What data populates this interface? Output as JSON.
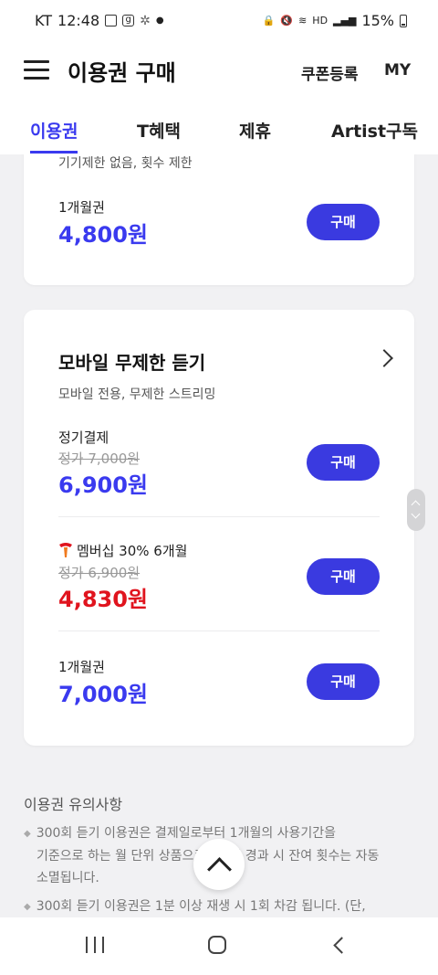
{
  "status_bar": {
    "carrier": "KT",
    "time": "12:48",
    "network_label": "HD",
    "battery": "15%"
  },
  "header": {
    "title": "이용권 구매",
    "coupon_label": "쿠폰등록",
    "my_label": "MY"
  },
  "tabs": [
    {
      "label": "이용권",
      "active": true
    },
    {
      "label": "T혜택",
      "active": false
    },
    {
      "label": "제휴",
      "active": false
    },
    {
      "label": "Artist구독",
      "active": false
    }
  ],
  "card1": {
    "desc_partial": "기기제한 없음, 횟수 제한",
    "plan_label": "1개월권",
    "price": "4,800원",
    "buy_label": "구매"
  },
  "card2": {
    "title": "모바일 무제한 듣기",
    "desc": "모바일 전용, 무제한 스트리밍",
    "plans": [
      {
        "label": "정기결제",
        "original_price": "정가 7,000원",
        "price": "6,900원",
        "buy_label": "구매"
      },
      {
        "label": "멤버십 30% 6개월",
        "original_price": "정가 6,900원",
        "price": "4,830원",
        "buy_label": "구매"
      },
      {
        "label": "1개월권",
        "price": "7,000원",
        "buy_label": "구매"
      }
    ]
  },
  "notes": {
    "title": "이용권 유의사항",
    "items": [
      {
        "line1": "300회 듣기 이용권은 결제일로부터 1개월의 사용기간을",
        "line2": "기준으로 하는 월 단위 상품으로 1개월 경과 시 잔여 횟수는 자동",
        "line3": "소멸됩니다."
      },
      {
        "line1": "300회 듣기 이용권은 1분 이상 재생 시 1회 차감 됩니다. (단,"
      }
    ]
  },
  "colors": {
    "accent": "#3a3aef",
    "button": "#3a3ae0",
    "discount_red": "#e0141e",
    "background": "#f1f1f3"
  },
  "icons": [
    "hamburger-menu-icon",
    "chevron-right-icon",
    "t-membership-logo-icon",
    "scroll-to-top-icon",
    "recent-apps-icon",
    "home-icon",
    "back-icon"
  ]
}
